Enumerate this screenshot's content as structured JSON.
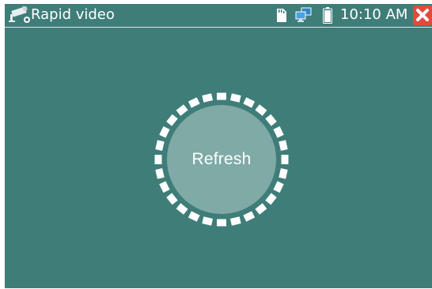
{
  "status_bar": {
    "app_title": "Rapid video",
    "app_icon": "cctv-camera-icon",
    "icons": [
      "sd-card-icon",
      "network-icon",
      "battery-icon"
    ],
    "time": "10:10 AM",
    "close_icon": "close-icon"
  },
  "main": {
    "refresh_button": {
      "label": "Refresh"
    },
    "spinner": {
      "dash_count": 28
    }
  },
  "colors": {
    "background": "#3f7d79",
    "button_fill": "#7faaa6",
    "close_button": "#e14b3d",
    "text": "#ffffff"
  }
}
